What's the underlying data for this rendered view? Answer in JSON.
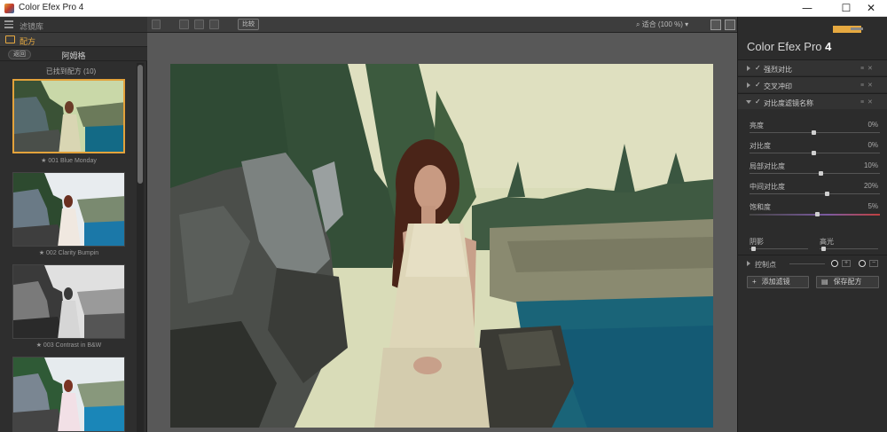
{
  "window": {
    "title": "Color Efex Pro 4",
    "minimize": "—",
    "maximize": "☐",
    "close": "✕"
  },
  "left_panel": {
    "library_label": "滤镜库",
    "recipes_label": "配方",
    "back_button": "返回",
    "breadcrumb": "阿姆格",
    "section_title": "已找到配方 (10)",
    "presets": [
      {
        "caption": "★ 001 Blue Monday"
      },
      {
        "caption": "★ 002 Clarity Bumpin"
      },
      {
        "caption": "★ 003 Contrast in B&W"
      },
      {
        "caption": ""
      }
    ]
  },
  "toolbar": {
    "compare_label": "比较",
    "zoom_label": "适合 (100 %)"
  },
  "right_panel": {
    "app_name": "Color Efex Pro",
    "version": "4",
    "filters": [
      {
        "name": "强烈对比",
        "checked": "✓"
      },
      {
        "name": "交叉冲印",
        "checked": "✓"
      },
      {
        "name": "对比度滤镜名称",
        "checked": "✓"
      }
    ],
    "params": [
      {
        "label": "亮度",
        "value": "0%",
        "level": 0.5
      },
      {
        "label": "对比度",
        "value": "0%",
        "level": 0.5
      },
      {
        "label": "局部对比度",
        "value": "10%",
        "level": 0.55
      },
      {
        "label": "中间对比度",
        "value": "20%",
        "level": 0.6
      },
      {
        "label": "饱和度",
        "value": "5%",
        "level": 0.52
      }
    ],
    "shadows_label": "阴影",
    "highlights_label": "高光",
    "control_points_label": "控制点",
    "add_filter_button": "添加滤镜",
    "save_recipe_button": "保存配方"
  }
}
